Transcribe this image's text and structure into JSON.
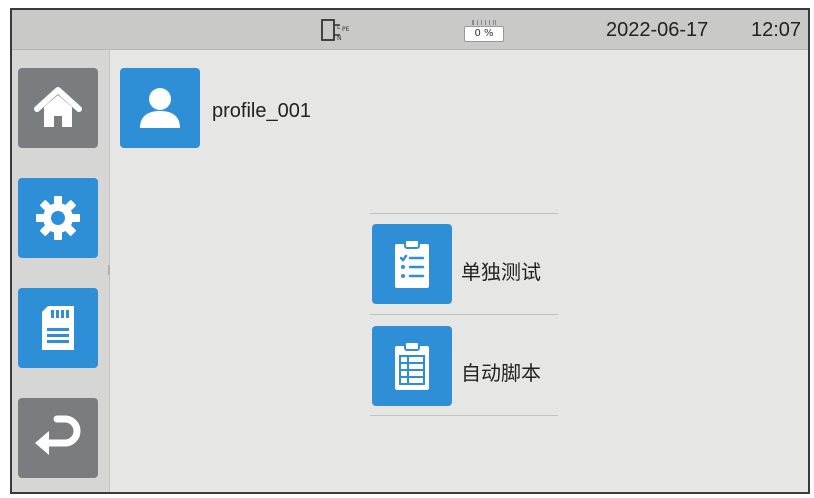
{
  "status_bar": {
    "plug_icon": "mains-plug-icon",
    "battery_icon": "battery-icon",
    "battery_level": "0 %",
    "date": "2022-06-17",
    "time": "12:07"
  },
  "sidebar": {
    "items": [
      {
        "name": "home",
        "icon": "home-icon"
      },
      {
        "name": "settings",
        "icon": "gear-icon"
      },
      {
        "name": "memory",
        "icon": "sd-card-icon"
      },
      {
        "name": "back",
        "icon": "return-arrow-icon"
      }
    ]
  },
  "profile": {
    "icon": "user-icon",
    "label": "profile_001"
  },
  "menu": {
    "items": [
      {
        "label": "单独测试",
        "icon": "checklist-clipboard-icon"
      },
      {
        "label": "自动脚本",
        "icon": "script-clipboard-icon"
      }
    ]
  },
  "colors": {
    "accent_blue": "#2f8fd6",
    "sidebar_grey": "#7a7d80",
    "background": "#e6e6e4",
    "status_bar": "#c9c9c7"
  }
}
